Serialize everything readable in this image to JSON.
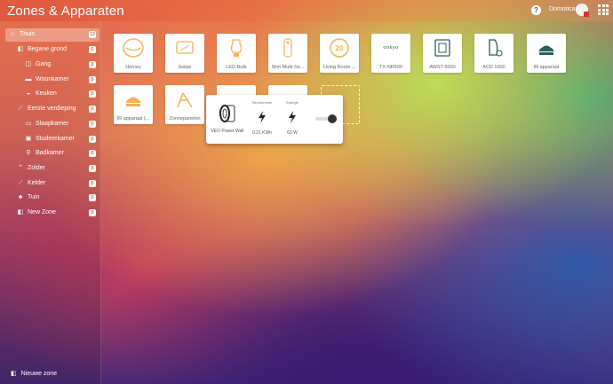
{
  "header": {
    "title": "Zones & Apparaten",
    "help_label": "?",
    "user_name": "Domotica"
  },
  "sidebar": {
    "zones": [
      {
        "label": "Thuis",
        "count": "13",
        "icon": "house-icon",
        "level": 0,
        "active": true
      },
      {
        "label": "Begane grond",
        "count": "0",
        "icon": "floor-plan-icon",
        "level": 1
      },
      {
        "label": "Gang",
        "count": "0",
        "icon": "door-icon",
        "level": 2
      },
      {
        "label": "Woonkamer",
        "count": "0",
        "icon": "sofa-icon",
        "level": 2
      },
      {
        "label": "Keuken",
        "count": "0",
        "icon": "pot-icon",
        "level": 2
      },
      {
        "label": "Eerste verdieping",
        "count": "0",
        "icon": "stairs-icon",
        "level": 1
      },
      {
        "label": "Slaapkamer",
        "count": "0",
        "icon": "bed-icon",
        "level": 2
      },
      {
        "label": "Studeerkamer",
        "count": "0",
        "icon": "desk-icon",
        "level": 2
      },
      {
        "label": "Badkamer",
        "count": "0",
        "icon": "shower-icon",
        "level": 2
      },
      {
        "label": "Zolder",
        "count": "0",
        "icon": "roof-icon",
        "level": 1
      },
      {
        "label": "Kelder",
        "count": "0",
        "icon": "basement-stairs-icon",
        "level": 1
      },
      {
        "label": "Tuin",
        "count": "0",
        "icon": "tree-icon",
        "level": 1
      },
      {
        "label": "New Zone",
        "count": "0",
        "icon": "zone-icon",
        "level": 1
      }
    ],
    "new_zone_label": "Nieuwe zone"
  },
  "devices": [
    {
      "label": "Homey",
      "icon": "homey-icon"
    },
    {
      "label": "Swipe",
      "icon": "swipe-icon"
    },
    {
      "label": "LED Bulb",
      "icon": "bulb-icon"
    },
    {
      "label": "Slim Multi-Se...",
      "icon": "multisensor-icon"
    },
    {
      "label": "Living Room ...",
      "icon": "thermostat-icon",
      "badge": "20"
    },
    {
      "label": "TX-NR509",
      "icon": "receiver-icon",
      "badge": "onkyo"
    },
    {
      "label": "AWST 6000",
      "icon": "wall-switch-icon"
    },
    {
      "label": "ACD 1000",
      "icon": "dimmer-icon"
    },
    {
      "label": "IR apparaat",
      "icon": "ir-blaster-icon"
    },
    {
      "label": "IR apparaat (...",
      "icon": "ir-blaster-icon"
    },
    {
      "label": "Zonnepanelen",
      "icon": "solar-panel-icon"
    }
  ],
  "popup": {
    "device_name": "VEO Power Wall",
    "capabilities": [
      {
        "label": "Stroommeter",
        "value": "0.21 KWh",
        "icon": "lightning-icon"
      },
      {
        "label": "Energie",
        "value": "63 W",
        "icon": "lightning-icon"
      }
    ],
    "toggle_on": true
  },
  "colors": {
    "accent": "#d53030",
    "tile_icon": "#f2b25a",
    "tile_dark": "#2c5f5a",
    "tile_text": "#666666"
  }
}
